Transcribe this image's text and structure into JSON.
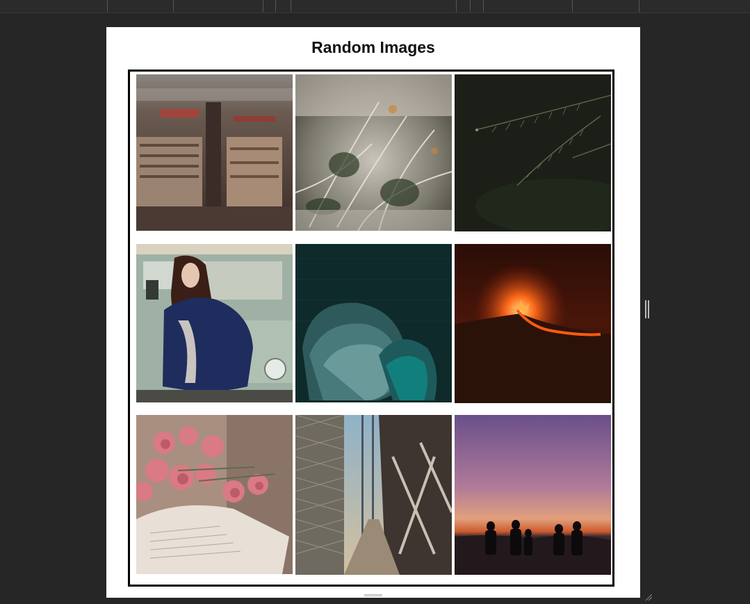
{
  "page": {
    "title": "Random Images"
  },
  "gallery": {
    "images": [
      {
        "name": "city-aerial"
      },
      {
        "name": "frosty-fern"
      },
      {
        "name": "pine-branch"
      },
      {
        "name": "woman-with-car"
      },
      {
        "name": "teal-abstract"
      },
      {
        "name": "volcano-eruption"
      },
      {
        "name": "roses-on-book"
      },
      {
        "name": "bridge-walkway"
      },
      {
        "name": "sunset-silhouettes"
      }
    ]
  }
}
